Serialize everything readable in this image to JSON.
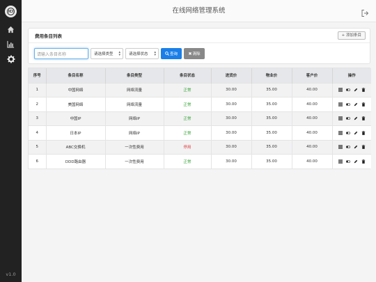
{
  "app": {
    "title": "在线网络管理系统",
    "version": "v1.0"
  },
  "sidebar": {
    "logo_text": "ICI",
    "items": [
      {
        "icon": "home-icon"
      },
      {
        "icon": "bar-chart-icon"
      },
      {
        "icon": "gear-icon"
      }
    ]
  },
  "panel": {
    "title": "费用条目列表",
    "add_button": "+ 添加条目",
    "search_placeholder": "请输入条目名称",
    "type_select": "请选择类型",
    "status_select": "请选择状态",
    "query_button": "查询",
    "reset_button": "清除"
  },
  "table": {
    "headers": [
      "序号",
      "条目名称",
      "条目类型",
      "条目状态",
      "进货价",
      "物业价",
      "客户价",
      "操作"
    ],
    "rows": [
      {
        "no": "1",
        "name": "中国网络",
        "type": "网络流量",
        "status": "正常",
        "cost": "30.00",
        "property": "35.00",
        "customer": "40.00"
      },
      {
        "no": "2",
        "name": "美国网络",
        "type": "网络流量",
        "status": "正常",
        "cost": "30.00",
        "property": "35.00",
        "customer": "40.00"
      },
      {
        "no": "3",
        "name": "中国IP",
        "type": "网络IP",
        "status": "正常",
        "cost": "30.00",
        "property": "35.00",
        "customer": "40.00"
      },
      {
        "no": "4",
        "name": "日本IP",
        "type": "网络IP",
        "status": "正常",
        "cost": "30.00",
        "property": "35.00",
        "customer": "40.00"
      },
      {
        "no": "5",
        "name": "ABC交换机",
        "type": "一次性费用",
        "status": "停用",
        "cost": "30.00",
        "property": "35.00",
        "customer": "40.00"
      },
      {
        "no": "6",
        "name": "DDD路由器",
        "type": "一次性费用",
        "status": "正常",
        "cost": "30.00",
        "property": "35.00",
        "customer": "40.00"
      }
    ]
  },
  "colors": {
    "sidebar": "#222222",
    "primary": "#1a7fe8",
    "ok": "#2ca02c",
    "stopped": "#e03c3c"
  }
}
